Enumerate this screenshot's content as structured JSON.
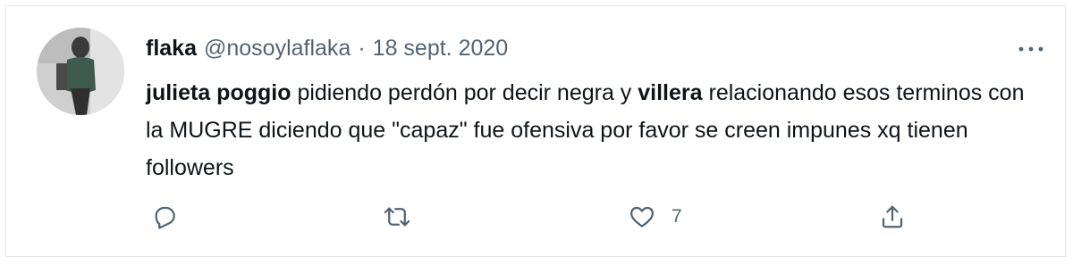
{
  "tweet": {
    "display_name": "flaka",
    "handle": "@nosoylaflaka",
    "separator": "·",
    "date": "18 sept. 2020",
    "text": {
      "part1_bold": "julieta poggio",
      "part2": " pidiendo perdón por decir negra y ",
      "part3_bold": "villera",
      "part4": " relacionando esos terminos con la MUGRE diciendo que \"capaz\" fue ofensiva por favor se creen impunes xq tienen followers"
    },
    "actions": {
      "reply_icon": "reply-icon",
      "retweet_icon": "retweet-icon",
      "like_icon": "heart-icon",
      "like_count": "7",
      "share_icon": "share-icon"
    },
    "more_icon": "more-options-icon",
    "colors": {
      "text": "#0f1419",
      "secondary": "#536471",
      "border": "#e1e8ed"
    }
  }
}
